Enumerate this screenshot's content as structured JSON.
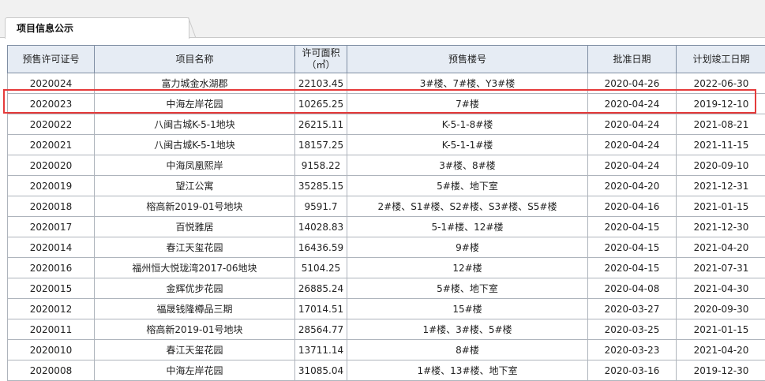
{
  "tab": {
    "title": "项目信息公示"
  },
  "table": {
    "headers": [
      "预售许可证号",
      "项目名称",
      "许可面积\n（㎡）",
      "预售楼号",
      "批准日期",
      "计划竣工日期"
    ],
    "rows": [
      [
        "2020024",
        "富力城金水湖郡",
        "22103.45",
        "3#楼、7#楼、Y3#楼",
        "2020-04-26",
        "2022-06-30"
      ],
      [
        "2020023",
        "中海左岸花园",
        "10265.25",
        "7#楼",
        "2020-04-24",
        "2019-12-10"
      ],
      [
        "2020022",
        "八闽古城K-5-1地块",
        "26215.11",
        "K-5-1-8#楼",
        "2020-04-24",
        "2021-08-21"
      ],
      [
        "2020021",
        "八闽古城K-5-1地块",
        "18157.25",
        "K-5-1-1#楼",
        "2020-04-24",
        "2021-11-15"
      ],
      [
        "2020020",
        "中海凤凰熙岸",
        "9158.22",
        "3#楼、8#楼",
        "2020-04-24",
        "2020-09-10"
      ],
      [
        "2020019",
        "望江公寓",
        "35285.15",
        "5#楼、地下室",
        "2020-04-20",
        "2021-12-31"
      ],
      [
        "2020018",
        "榕高新2019-01号地块",
        "9591.7",
        "2#楼、S1#楼、S2#楼、S3#楼、S5#楼",
        "2020-04-16",
        "2021-01-15"
      ],
      [
        "2020017",
        "百悦雅居",
        "14028.83",
        "5-1#楼、12#楼",
        "2020-04-15",
        "2021-12-30"
      ],
      [
        "2020014",
        "春江天玺花园",
        "16436.59",
        "9#楼",
        "2020-04-15",
        "2021-04-20"
      ],
      [
        "2020016",
        "福州恒大悦珑湾2017-06地块",
        "5104.25",
        "12#楼",
        "2020-04-15",
        "2021-07-31"
      ],
      [
        "2020015",
        "金辉优步花园",
        "26885.24",
        "5#楼、地下室",
        "2020-04-08",
        "2021-04-30"
      ],
      [
        "2020012",
        "福晟钱隆樽品三期",
        "17014.51",
        "15#楼",
        "2020-03-27",
        "2020-09-30"
      ],
      [
        "2020011",
        "榕高新2019-01号地块",
        "28564.77",
        "1#楼、3#楼、5#楼",
        "2020-03-25",
        "2021-01-15"
      ],
      [
        "2020010",
        "春江天玺花园",
        "13711.14",
        "8#楼",
        "2020-03-23",
        "2021-04-20"
      ],
      [
        "2020008",
        "中海左岸花园",
        "31085.04",
        "1#楼、13#楼、地下室",
        "2020-03-16",
        "2019-12-30"
      ]
    ],
    "highlighted_row": 1
  },
  "colors": {
    "header_bg": "#e6ecf4",
    "highlight": "#e53b3b",
    "border": "#aeb4bc"
  }
}
